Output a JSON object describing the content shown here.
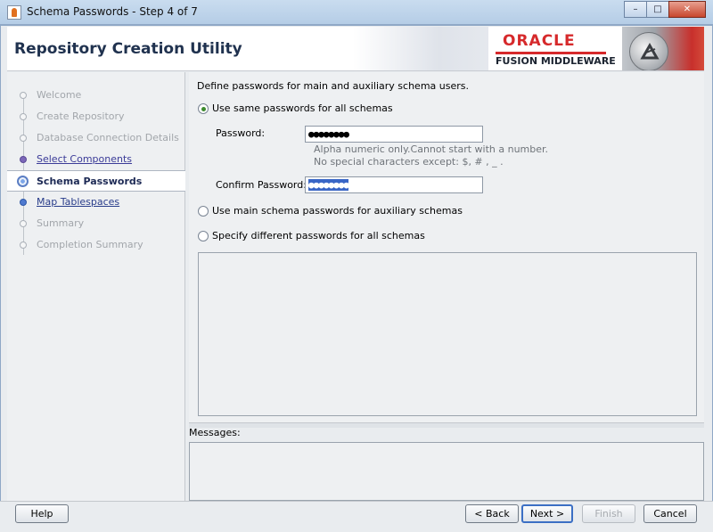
{
  "window": {
    "title": "Schema Passwords - Step 4 of 7",
    "controls": [
      "–",
      "□",
      "✕"
    ]
  },
  "header": {
    "app_title": "Repository Creation Utility",
    "brand_name": "ORACLE",
    "brand_sub": "FUSION MIDDLEWARE"
  },
  "nav": {
    "items": [
      {
        "label": "Welcome",
        "state": "done"
      },
      {
        "label": "Create Repository",
        "state": "done"
      },
      {
        "label": "Database Connection Details",
        "state": "done"
      },
      {
        "label": "Select Components",
        "state": "link"
      },
      {
        "label": "Schema Passwords",
        "state": "current"
      },
      {
        "label": "Map Tablespaces",
        "state": "next"
      },
      {
        "label": "Summary",
        "state": "disabled"
      },
      {
        "label": "Completion Summary",
        "state": "disabled"
      }
    ]
  },
  "main": {
    "intro": "Define passwords for main and auxiliary schema users.",
    "options": [
      {
        "label": "Use same passwords for all schemas",
        "selected": true
      },
      {
        "label": "Use main schema passwords for auxiliary schemas",
        "selected": false
      },
      {
        "label": "Specify different passwords for all schemas",
        "selected": false
      }
    ],
    "password_label": "Password:",
    "password_value": "●●●●●●●●",
    "hint_line1": "Alpha numeric only.Cannot start with a number.",
    "hint_line2": "No special characters except: $, # , _ .",
    "confirm_label": "Confirm Password:",
    "confirm_value": "●●●●●●●●"
  },
  "messages": {
    "label": "Messages:"
  },
  "buttons": {
    "help": "Help",
    "back": "< Back",
    "next": "Next >",
    "finish": "Finish",
    "cancel": "Cancel"
  },
  "colors": {
    "header_title": "#20324f",
    "oracle_red": "#d6292b",
    "selected_radio": "#3d8b2e",
    "selection": "#3966c6"
  }
}
